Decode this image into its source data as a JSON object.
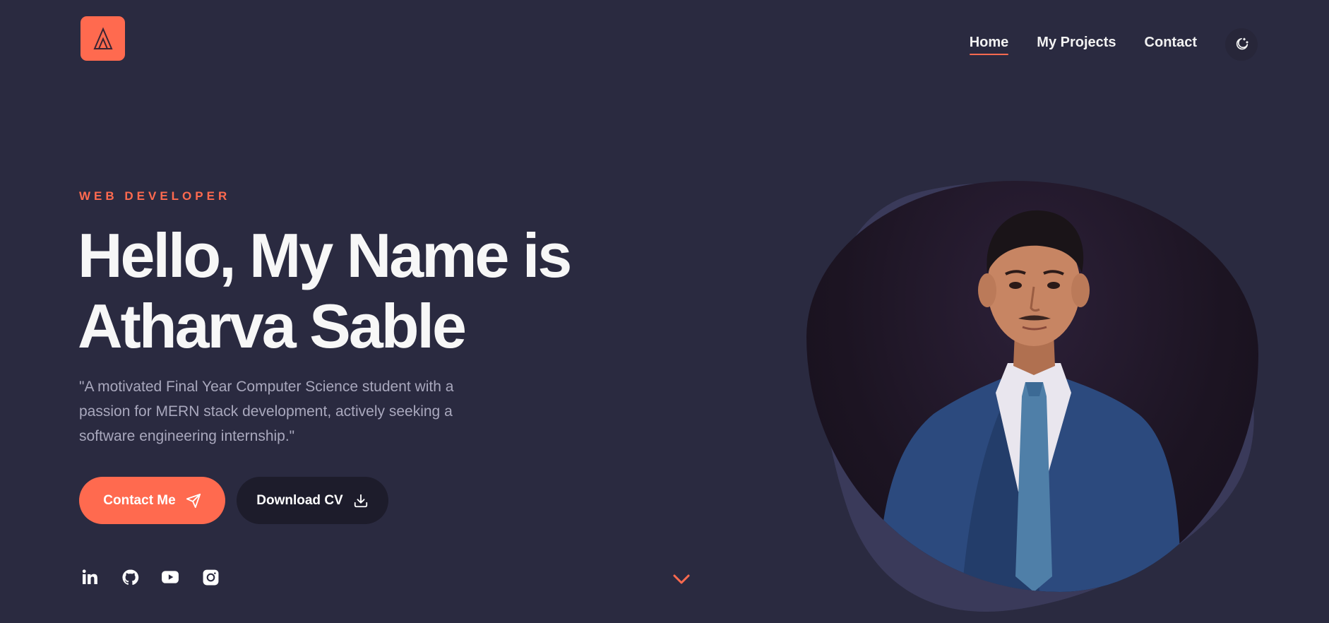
{
  "nav": {
    "links": [
      {
        "label": "Home",
        "active": true
      },
      {
        "label": "My Projects",
        "active": false
      },
      {
        "label": "Contact",
        "active": false
      }
    ],
    "theme_icon": "moon-stars-icon"
  },
  "logo": {
    "icon": "a-letter-logo"
  },
  "hero": {
    "subtitle": "WEB DEVELOPER",
    "headline_line1": "Hello, My Name is",
    "headline_line2": "Atharva Sable",
    "description": "\"A motivated Final Year Computer Science student with a passion for MERN stack development, actively seeking a software engineering internship.\"",
    "primary_button": "Contact Me",
    "primary_button_icon": "send-icon",
    "secondary_button": "Download CV",
    "secondary_button_icon": "download-icon"
  },
  "socials": [
    {
      "name": "linkedin-icon"
    },
    {
      "name": "github-icon"
    },
    {
      "name": "youtube-icon"
    },
    {
      "name": "instagram-icon"
    }
  ],
  "colors": {
    "background": "#2a2a40",
    "accent": "#ff6a4f",
    "text": "#f5f5f5",
    "muted": "#a9a8bd"
  }
}
